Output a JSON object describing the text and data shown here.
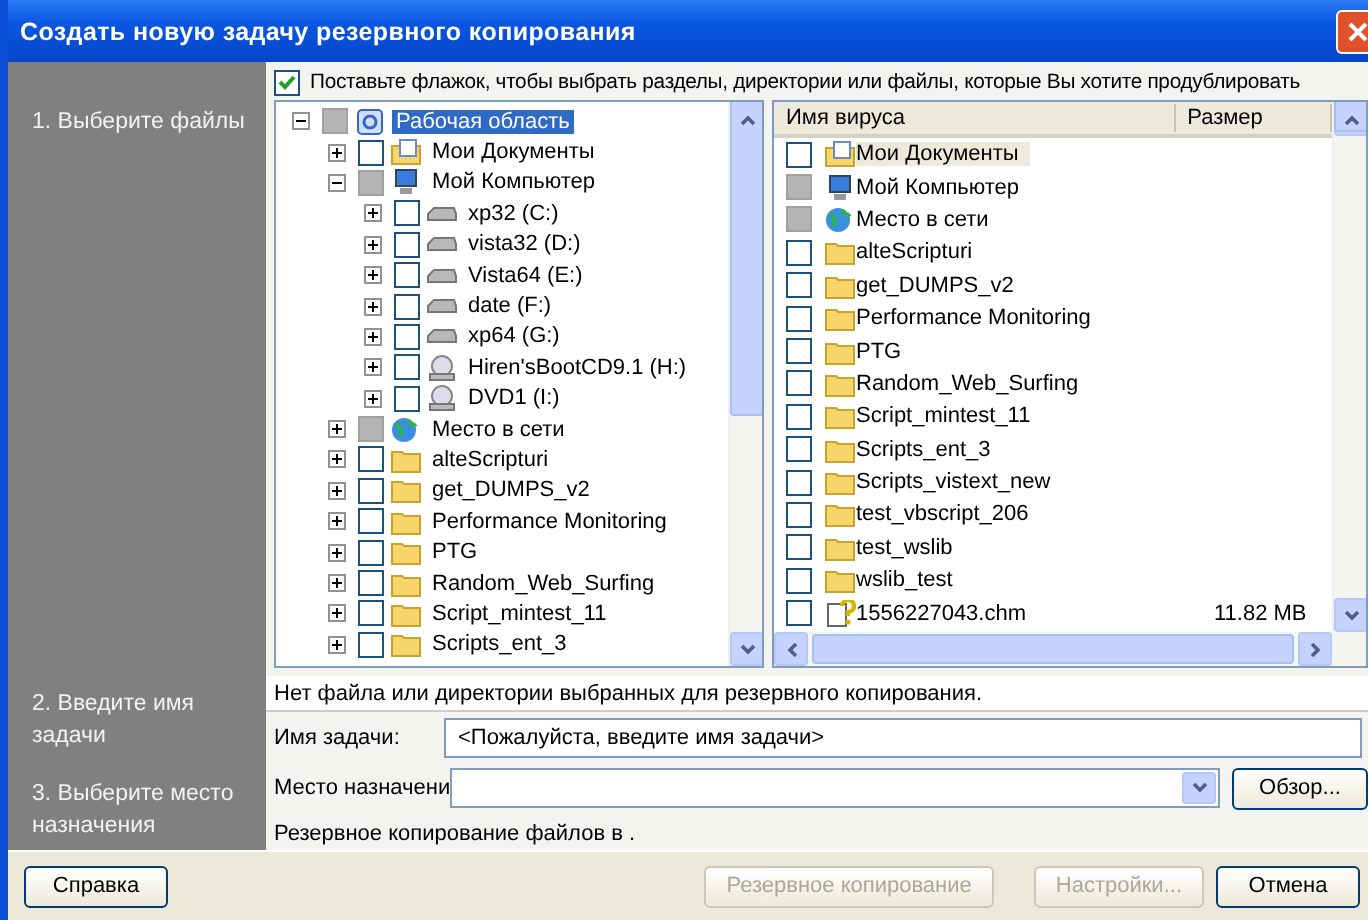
{
  "window": {
    "title": "Создать новую задачу резервного копирования"
  },
  "steps": [
    {
      "label": "1. Выберите файлы"
    },
    {
      "label": "2. Введите имя задачи"
    },
    {
      "label": "3. Выберите место назначения"
    }
  ],
  "select_all": {
    "label": "Поставьте флажок, чтобы выбрать разделы, директории или файлы, которые Вы хотите продублировать",
    "checked": true
  },
  "tree": [
    {
      "label": "Рабочая область",
      "kind": "desktop",
      "partial": true,
      "expanded": true,
      "selected": true,
      "children": [
        {
          "label": "Мои Документы",
          "kind": "docs",
          "partial": false,
          "expanded": false,
          "selected": false
        },
        {
          "label": "Мой Компьютер",
          "kind": "computer",
          "partial": true,
          "expanded": true,
          "selected": false,
          "children": [
            {
              "label": "xp32 (C:)",
              "kind": "drive",
              "partial": false,
              "expanded": false,
              "selected": false
            },
            {
              "label": "vista32 (D:)",
              "kind": "drive",
              "partial": false,
              "expanded": false,
              "selected": false
            },
            {
              "label": "Vista64 (E:)",
              "kind": "drive",
              "partial": false,
              "expanded": false,
              "selected": false
            },
            {
              "label": "date (F:)",
              "kind": "drive",
              "partial": false,
              "expanded": false,
              "selected": false
            },
            {
              "label": "xp64 (G:)",
              "kind": "drive",
              "partial": false,
              "expanded": false,
              "selected": false
            },
            {
              "label": "Hiren'sBootCD9.1 (H:)",
              "kind": "cd",
              "partial": false,
              "expanded": false,
              "selected": false
            },
            {
              "label": "DVD1 (I:)",
              "kind": "cd",
              "partial": false,
              "expanded": false,
              "selected": false
            }
          ]
        },
        {
          "label": "Место в сети",
          "kind": "network",
          "partial": true,
          "expanded": false,
          "selected": false
        },
        {
          "label": "alteScripturi",
          "kind": "folder",
          "partial": false,
          "expanded": false,
          "selected": false
        },
        {
          "label": "get_DUMPS_v2",
          "kind": "folder",
          "partial": false,
          "expanded": false,
          "selected": false
        },
        {
          "label": "Performance Monitoring",
          "kind": "folder",
          "partial": false,
          "expanded": false,
          "selected": false
        },
        {
          "label": "PTG",
          "kind": "folder",
          "partial": false,
          "expanded": false,
          "selected": false
        },
        {
          "label": "Random_Web_Surfing",
          "kind": "folder",
          "partial": false,
          "expanded": false,
          "selected": false
        },
        {
          "label": "Script_mintest_11",
          "kind": "folder",
          "partial": false,
          "expanded": false,
          "selected": false
        },
        {
          "label": "Scripts_ent_3",
          "kind": "folder",
          "partial": false,
          "expanded": false,
          "selected": false
        }
      ]
    }
  ],
  "list": {
    "columns": [
      "Имя вируса",
      "Размер"
    ],
    "rows": [
      {
        "name": "Мои Документы",
        "size": "",
        "kind": "docs",
        "partial": false,
        "selected": true
      },
      {
        "name": "Мой Компьютер",
        "size": "",
        "kind": "computer",
        "partial": true,
        "selected": false
      },
      {
        "name": "Место в сети",
        "size": "",
        "kind": "network",
        "partial": true,
        "selected": false
      },
      {
        "name": "alteScripturi",
        "size": "",
        "kind": "folder",
        "partial": false,
        "selected": false
      },
      {
        "name": "get_DUMPS_v2",
        "size": "",
        "kind": "folder",
        "partial": false,
        "selected": false
      },
      {
        "name": "Performance Monitoring",
        "size": "",
        "kind": "folder",
        "partial": false,
        "selected": false
      },
      {
        "name": "PTG",
        "size": "",
        "kind": "folder",
        "partial": false,
        "selected": false
      },
      {
        "name": "Random_Web_Surfing",
        "size": "",
        "kind": "folder",
        "partial": false,
        "selected": false
      },
      {
        "name": "Script_mintest_11",
        "size": "",
        "kind": "folder",
        "partial": false,
        "selected": false
      },
      {
        "name": "Scripts_ent_3",
        "size": "",
        "kind": "folder",
        "partial": false,
        "selected": false
      },
      {
        "name": "Scripts_vistext_new",
        "size": "",
        "kind": "folder",
        "partial": false,
        "selected": false
      },
      {
        "name": "test_vbscript_206",
        "size": "",
        "kind": "folder",
        "partial": false,
        "selected": false
      },
      {
        "name": "test_wslib",
        "size": "",
        "kind": "folder",
        "partial": false,
        "selected": false
      },
      {
        "name": "wslib_test",
        "size": "",
        "kind": "folder",
        "partial": false,
        "selected": false
      },
      {
        "name": "1556227043.chm",
        "size": "11.82 MB",
        "kind": "chm",
        "partial": false,
        "selected": false
      }
    ]
  },
  "status": "Нет файла или директории выбранных для резервного копирования.",
  "task_name": {
    "label": "Имя задачи:",
    "value": "<Пожалуйста, введите имя задачи>"
  },
  "destination": {
    "label": "Место назначени",
    "browse": "Обзор..."
  },
  "summary": "Резервное копирование файлов в .",
  "buttons": [
    {
      "label": "Справка",
      "disabled": false
    },
    {
      "label": "Резервное копирование",
      "disabled": true
    },
    {
      "label": "Настройки...",
      "disabled": true
    },
    {
      "label": "Отмена",
      "disabled": false
    }
  ]
}
